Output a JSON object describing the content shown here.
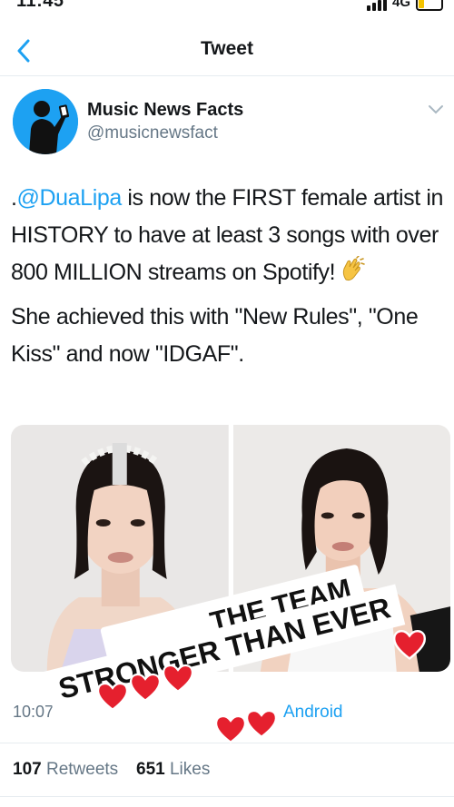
{
  "status_bar": {
    "time": "11:45",
    "network": "4G",
    "battery_color": "#f5c400"
  },
  "nav": {
    "title": "Tweet",
    "back_icon": "chevron-left-icon"
  },
  "author": {
    "name": "Music News Facts",
    "handle": "@musicnewsfact",
    "avatar_color": "#1da1f2"
  },
  "tweet": {
    "prefix": ".",
    "mention": "@DuaLipa",
    "body_1": " is now the FIRST female artist in HISTORY to have at least 3 songs with over 800 MILLION streams on Spotify!",
    "body_1_emoji": "clapping-hands-icon",
    "body_2": "She achieved this with \"New Rules\", \"One Kiss\" and now \"IDGAF\".",
    "timestamp": "10:07",
    "via": "Android"
  },
  "stats": {
    "retweets_count": "107",
    "retweets_label": "Retweets",
    "likes_count": "651",
    "likes_label": "Likes"
  },
  "sticker": {
    "line_1": "THE TEAM",
    "line_2": "STRONGER THAN EVER",
    "heart_color": "#e5202e"
  },
  "colors": {
    "accent": "#1da1f2",
    "muted": "#657786",
    "divider": "#e6ecf0"
  }
}
